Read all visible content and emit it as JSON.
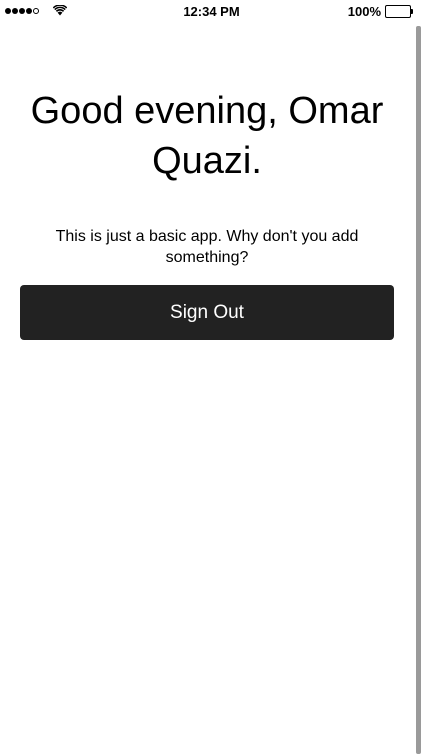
{
  "status_bar": {
    "time": "12:34 PM",
    "battery_percent": "100%",
    "signal_bars_filled": 4,
    "signal_bars_total": 5
  },
  "main": {
    "greeting": "Good evening, Omar Quazi.",
    "subtitle": "This is just a basic app. Why don't you add something?",
    "sign_out_label": "Sign Out"
  },
  "colors": {
    "button_background": "#222222",
    "button_text": "#ffffff",
    "page_background": "#ffffff"
  }
}
